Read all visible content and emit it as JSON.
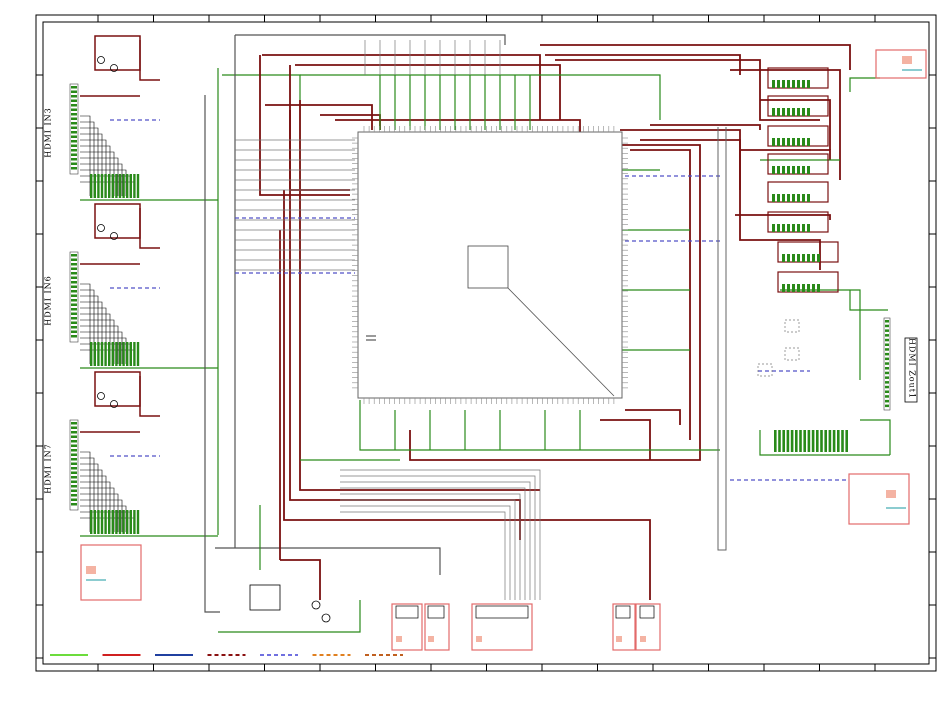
{
  "connectors": {
    "in3": "HDMI IN3",
    "in6": "HDMI IN6",
    "in7": "HDMI IN7",
    "out2": "HDMI Zout1"
  },
  "colors": {
    "background": "#ffffff",
    "frame": "#000000",
    "net_green": "#2a8a1a",
    "net_darkred": "#7a1010",
    "net_gray": "#555555",
    "net_blue_dashed": "#5050c8",
    "highlight_pink": "#e26a6a",
    "legend": [
      "#6cdc3c",
      "#d02020",
      "#2040a0",
      "#8a1010",
      "#7070e0",
      "#e08020",
      "#c06020"
    ]
  },
  "legend_styles": [
    "solid",
    "solid",
    "solid",
    "dashed",
    "dashed",
    "dashed",
    "dashed"
  ]
}
